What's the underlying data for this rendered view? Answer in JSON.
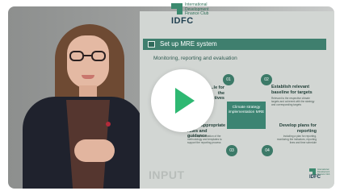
{
  "video": {
    "slide": {
      "logo": {
        "abbr": "IDFC",
        "full": "International Development Finance Club"
      },
      "header_title": "Set up MRE system",
      "subtitle": "Monitoring, reporting and evaluation",
      "center_box": "Climate strategy implementation MRE",
      "quadrants": [
        {
          "number": "01",
          "title": "...le for the ...tives",
          "body": ""
        },
        {
          "number": "02",
          "title": "Establish relevant baseline for targets",
          "body": "Relevant to the respective climate targets and coherent with the strategy and corresponding targets"
        },
        {
          "number": "03",
          "title": "Setup appropriate rules and guidance",
          "body": "For the implementation of the methodology and templates to support the reporting process"
        },
        {
          "number": "04",
          "title": "Develop plans for reporting",
          "body": "Including a plan for reporting, monitoring the indicators, reporting lines and time schedule"
        }
      ],
      "footer_label": "INPUT"
    },
    "play_button": {
      "icon": "play-icon",
      "color": "#2eb872"
    }
  }
}
